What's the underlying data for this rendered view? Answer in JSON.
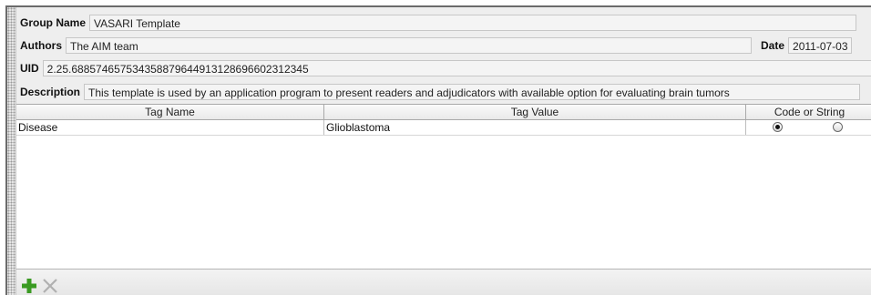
{
  "group": {
    "label": "Group Name",
    "value": "VASARI Template"
  },
  "authors": {
    "label": "Authors",
    "value": "The AIM team"
  },
  "date": {
    "label": "Date",
    "value": "2011-07-03"
  },
  "uid": {
    "label": "UID",
    "value": "2.25.688574657534358879644913128696602312345"
  },
  "description": {
    "label": "Description",
    "value": "This template is used by an application program to present readers and adjudicators with available option for evaluating brain tumors"
  },
  "table": {
    "headers": [
      "Tag Name",
      "Tag Value",
      "Code or String"
    ],
    "rows": [
      {
        "name": "Disease",
        "value": "Glioblastoma",
        "code_selected": true,
        "string_selected": false
      }
    ]
  },
  "toolbar": {
    "add_icon": "plus-icon",
    "remove_icon": "x-icon",
    "add_color": "#3a9a22",
    "remove_color": "#b0b0b0"
  }
}
